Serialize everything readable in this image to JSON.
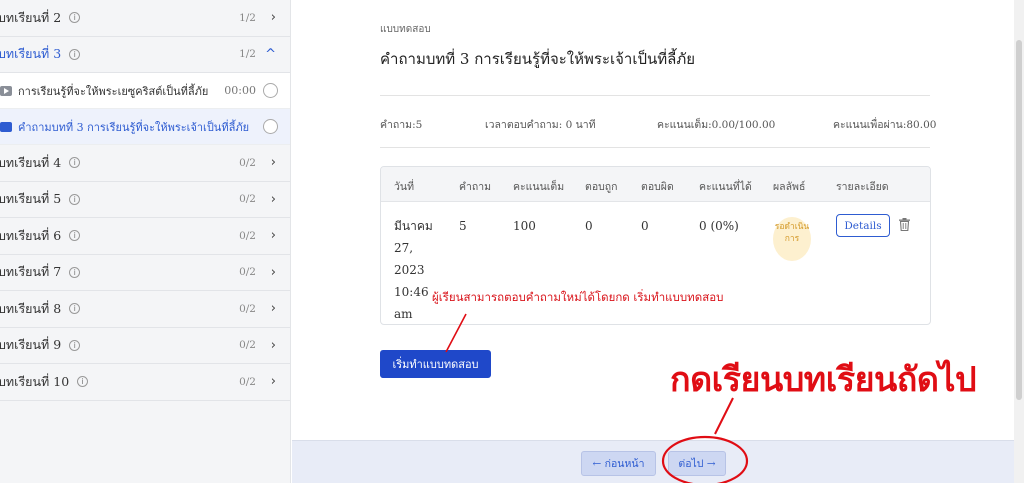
{
  "sidebar": {
    "lessons_top": [
      {
        "name": "บทเรียนที่ 2",
        "count": "1/2",
        "chevron": "›"
      },
      {
        "name": "บทเรียนที่ 3",
        "count": "1/2",
        "chevron": "^"
      }
    ],
    "sub_items": [
      {
        "icon": "video-icon",
        "text": "การเรียนรู้ที่จะให้พระเยซูคริสต์เป็นที่ลี้ภัย",
        "time": "00:00"
      },
      {
        "icon": "quiz-icon",
        "text": "คำถามบทที่ 3 การเรียนรู้ที่จะให้พระเจ้าเป็นที่ลี้ภัย",
        "time": ""
      }
    ],
    "lessons_bottom": [
      {
        "name": "บทเรียนที่ 4",
        "count": "0/2"
      },
      {
        "name": "บทเรียนที่ 5",
        "count": "0/2"
      },
      {
        "name": "บทเรียนที่ 6",
        "count": "0/2"
      },
      {
        "name": "บทเรียนที่ 7",
        "count": "0/2"
      },
      {
        "name": "บทเรียนที่ 8",
        "count": "0/2"
      },
      {
        "name": "บทเรียนที่ 9",
        "count": "0/2"
      },
      {
        "name": "บทเรียนที่ 10",
        "count": "0/2"
      }
    ],
    "info_glyph": "i"
  },
  "quiz": {
    "eyebrow": "แบบทดสอบ",
    "title": "คำถามบทที่ 3 การเรียนรู้ที่จะให้พระเจ้าเป็นที่ลี้ภัย",
    "meta": {
      "questions": "คำถาม:5",
      "time": "เวลาตอบคำถาม: 0 นาที",
      "full_score": "คะแนนเต็ม:0.00/100.00",
      "pass_score": "คะแนนเพื่อผ่าน:80.00"
    },
    "table": {
      "headers": [
        "วันที่",
        "คำถาม",
        "คะแนนเต็ม",
        "ตอบถูก",
        "ตอบผิด",
        "คะแนนที่ได้",
        "ผลลัพธ์",
        "รายละเอียด"
      ],
      "row": {
        "date_lines": [
          "มีนาคม",
          "27,",
          "2023",
          "10:46",
          "am"
        ],
        "questions": "5",
        "full": "100",
        "correct": "0",
        "wrong": "0",
        "score": "0 (0%)",
        "result": "รอดำเนินการ",
        "details_label": "Details"
      }
    },
    "start_button": "เริ่มทำแบบทดสอบ"
  },
  "annotations": {
    "hint": "ผู้เรียนสามารถตอบคำถามใหม่ได้โดยกด เริ่มทำแบบทดสอบ",
    "big": "กดเรียนบทเรียนถัดไป",
    "color": "#e00d14"
  },
  "footer": {
    "prev_label": "← ก่อนหน้า",
    "next_label": "ต่อไป →"
  }
}
